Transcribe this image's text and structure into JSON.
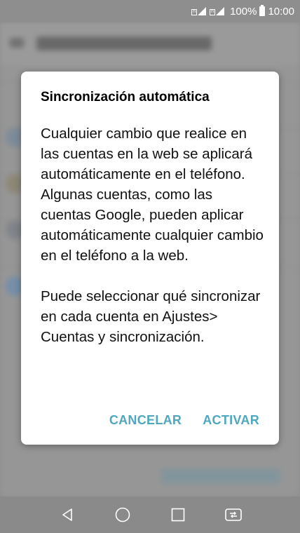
{
  "status_bar": {
    "battery": "100%",
    "time": "10:00",
    "sim1_label": "n",
    "sim2_label": "n"
  },
  "dialog": {
    "title": "Sincronización automática",
    "body_paragraph_1": "Cualquier cambio que realice en las cuentas en la web se aplicará automáticamente en el teléfono. Algunas cuentas, como las cuentas Google, pueden aplicar automáticamente cualquier cambio en el teléfono a la web.",
    "body_paragraph_2": "Puede seleccionar qué sincronizar en cada cuenta en Ajustes> Cuentas y sincronización.",
    "cancel_label": "CANCELAR",
    "activate_label": "ACTIVAR"
  },
  "colors": {
    "accent": "#4fa7be",
    "dialog_bg": "#ffffff",
    "nav_bar": "#8a8a8a"
  },
  "icons": {
    "nav_back": "back-triangle-icon",
    "nav_home": "home-circle-icon",
    "nav_recents": "recents-square-icon",
    "nav_dual_window": "dual-window-icon"
  }
}
